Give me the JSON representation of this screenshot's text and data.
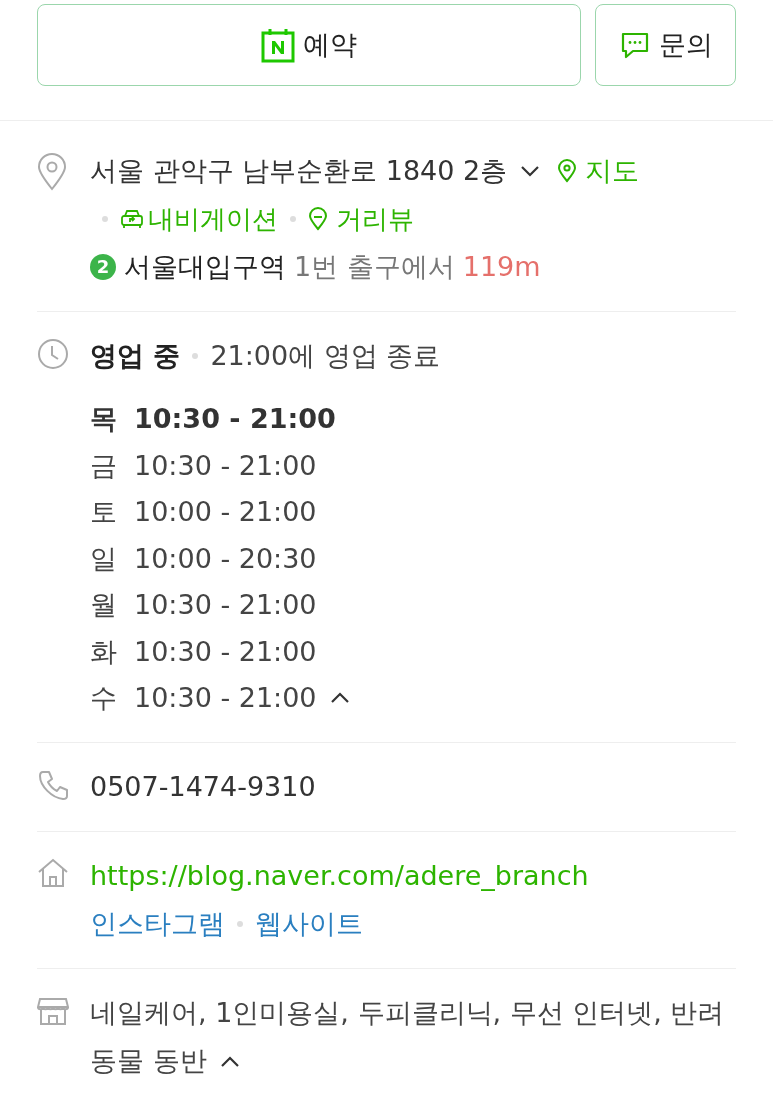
{
  "actions": [
    {
      "kind": "booking",
      "label": "예약"
    },
    {
      "kind": "inquiry",
      "label": "문의"
    }
  ],
  "address": {
    "text": "서울 관악구 남부순환로 1840 2층",
    "expanded": false,
    "map_link": "지도",
    "navigation_link": "내비게이션",
    "street_view_link": "거리뷰",
    "subway_line": "2",
    "station": "서울대입구역",
    "exit": "1번 출구에서",
    "distance": "119m"
  },
  "hours": {
    "status": "영업 중",
    "closing": "21:00에 영업 종료",
    "expanded": true,
    "days": [
      {
        "day": "목",
        "time": "10:30 - 21:00",
        "today": true
      },
      {
        "day": "금",
        "time": "10:30 - 21:00",
        "today": false
      },
      {
        "day": "토",
        "time": "10:00 - 21:00",
        "today": false
      },
      {
        "day": "일",
        "time": "10:00 - 20:30",
        "today": false
      },
      {
        "day": "월",
        "time": "10:30 - 21:00",
        "today": false
      },
      {
        "day": "화",
        "time": "10:30 - 21:00",
        "today": false
      },
      {
        "day": "수",
        "time": "10:30 - 21:00",
        "today": false
      }
    ]
  },
  "phone": "0507-1474-9310",
  "website": {
    "url": "https://blog.naver.com/adere_branch",
    "links": [
      "인스타그램",
      "웹사이트"
    ]
  },
  "amenities": {
    "text": "네일케어, 1인미용실, 두피클리닉, 무선 인터넷, 반려동물 동반",
    "expanded": true
  }
}
